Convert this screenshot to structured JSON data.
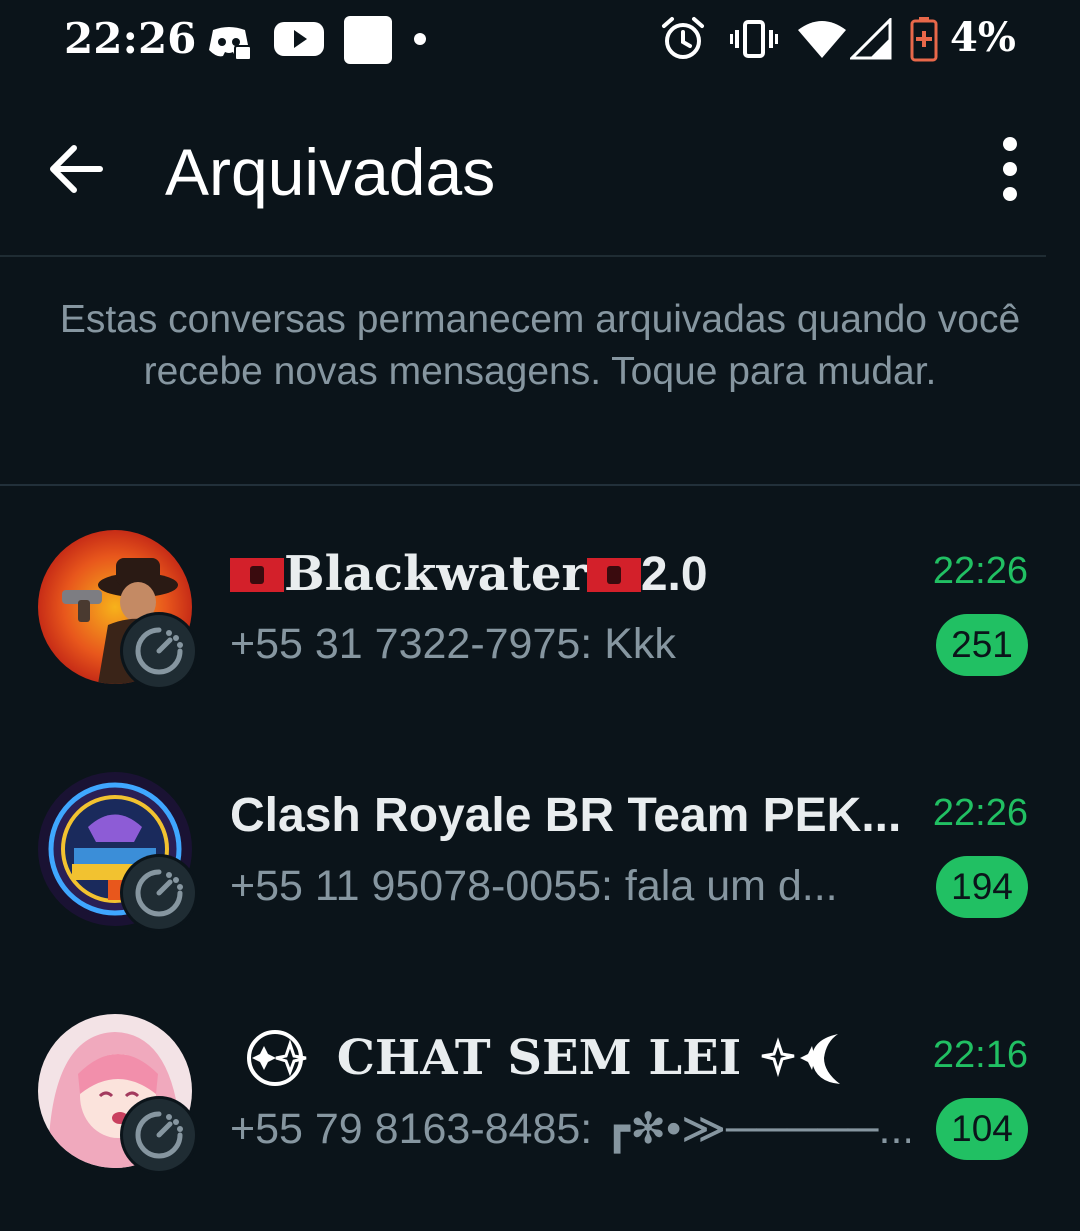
{
  "status_bar": {
    "time": "22:26",
    "battery_percent": "4%",
    "icons": [
      "discord-icon",
      "youtube-icon",
      "square-icon",
      "dot-icon",
      "alarm-icon",
      "vibrate-icon",
      "wifi-icon",
      "signal-icon",
      "battery-icon"
    ]
  },
  "app_bar": {
    "title": "Arquivadas",
    "back_icon": "arrow-back-icon",
    "menu_icon": "more-vert-icon"
  },
  "info_text": "Estas conversas permanecem arquivadas quando você recebe novas mensagens. Toque para mudar.",
  "chats": [
    {
      "name": "Blackwater",
      "name_suffix": "2.0",
      "last_message": "+55 31 7322-7975: Kkk",
      "time": "22:26",
      "unread": "251"
    },
    {
      "name": "Clash Royale BR Team PEK...",
      "last_message": "+55 11 95078-0055: fala um d...",
      "time": "22:26",
      "unread": "194"
    },
    {
      "name": "CHAT SEM LEI",
      "last_message": "+55 79 8163-8485: ┏✻•≫─────...",
      "time": "22:16",
      "unread": "104"
    }
  ],
  "colors": {
    "background": "#0b141a",
    "accent_green": "#21c063",
    "secondary_text": "#8696a0",
    "primary_text": "#e9edef",
    "battery_low": "#e8684a"
  }
}
